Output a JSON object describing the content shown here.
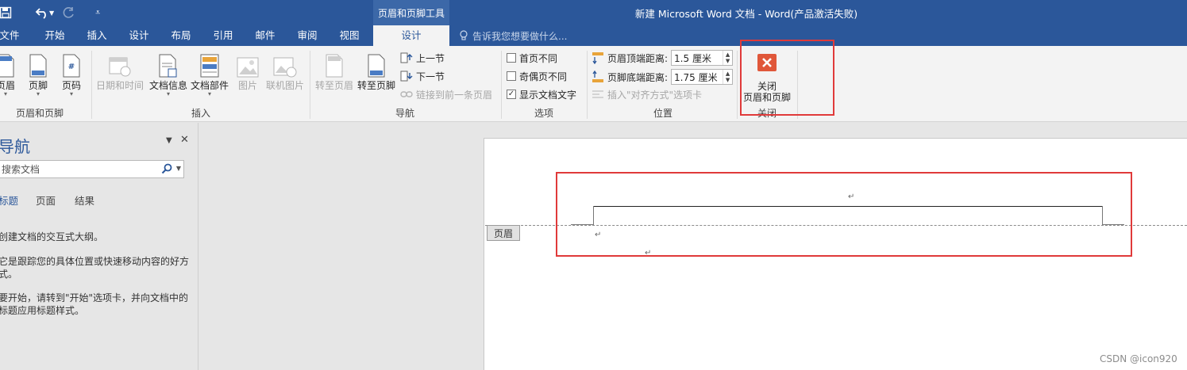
{
  "title_bar": {
    "context_tool": "页眉和页脚工具",
    "document_title": "新建 Microsoft Word 文档 - Word(产品激活失败)"
  },
  "tabs": [
    "文件",
    "开始",
    "插入",
    "设计",
    "布局",
    "引用",
    "邮件",
    "审阅",
    "视图",
    "设计"
  ],
  "tell_me": "告诉我您想要做什么...",
  "ribbon": {
    "header_footer_group": {
      "header": "页眉",
      "footer": "页脚",
      "page_number": "页码",
      "label": "页眉和页脚"
    },
    "insert_group": {
      "date_time": "日期和时间",
      "doc_info": "文档信息",
      "doc_parts": "文档部件",
      "picture": "图片",
      "online_picture": "联机图片",
      "label": "插入"
    },
    "navigation_group": {
      "go_to_header": "转至页眉",
      "go_to_footer": "转至页脚",
      "previous": "上一节",
      "next": "下一节",
      "link_previous": "链接到前一条页眉",
      "label": "导航"
    },
    "options_group": {
      "different_first": "首页不同",
      "different_odd_even": "奇偶页不同",
      "show_doc_text": "显示文档文字",
      "show_doc_text_checked": true,
      "label": "选项"
    },
    "position_group": {
      "header_top_label": "页眉顶端距离:",
      "header_top_value": "1.5 厘米",
      "footer_bottom_label": "页脚底端距离:",
      "footer_bottom_value": "1.75 厘米",
      "insert_align_tab": "插入\"对齐方式\"选项卡",
      "label": "位置"
    },
    "close_group": {
      "close_line1": "关闭",
      "close_line2": "页眉和页脚",
      "label": "关闭"
    }
  },
  "nav_pane": {
    "title": "导航",
    "search_placeholder": "搜索文档",
    "tabs": [
      "标题",
      "页面",
      "结果"
    ],
    "text1": "创建文档的交互式大纲。",
    "text2a": "它是跟踪您的具体位置或快速移动内容的好方",
    "text2b": "式。",
    "text3a": "要开始，请转到\"开始\"选项卡，并向文档中的",
    "text3b": "标题应用标题样式。"
  },
  "document": {
    "header_tag": "页眉",
    "paragraph_mark": "↵"
  },
  "watermark": "CSDN @icon920",
  "colors": {
    "word_blue": "#2b579a",
    "ribbon_bg": "#f3f3f3",
    "highlight_red": "#e03a3a",
    "close_icon_orange": "#e0573a"
  }
}
